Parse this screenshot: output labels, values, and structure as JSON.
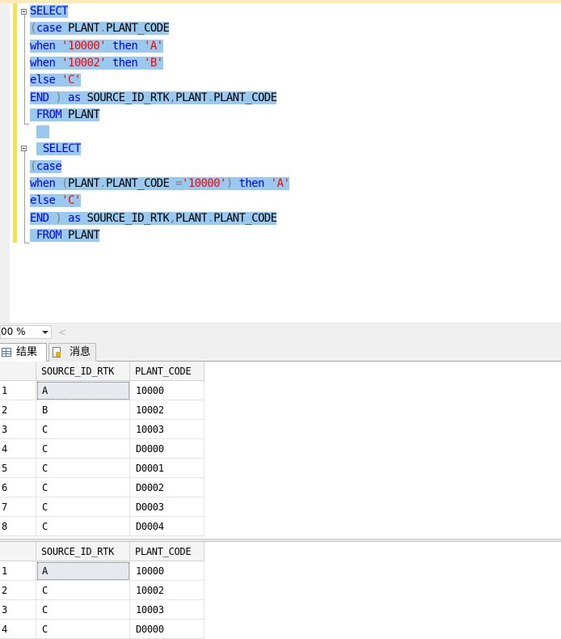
{
  "editor": {
    "lines": [
      [
        {
          "t": "SELECT",
          "c": "kw"
        }
      ],
      [
        {
          "t": "(",
          "c": "op"
        },
        {
          "t": "case",
          "c": "kw"
        },
        {
          "t": " PLANT",
          "c": "id"
        },
        {
          "t": ".",
          "c": "op"
        },
        {
          "t": "PLANT_CODE",
          "c": "id"
        }
      ],
      [
        {
          "t": "when",
          "c": "kw"
        },
        {
          "t": " ",
          "c": "id"
        },
        {
          "t": "'10000'",
          "c": "str"
        },
        {
          "t": " ",
          "c": "id"
        },
        {
          "t": "then",
          "c": "kw"
        },
        {
          "t": " ",
          "c": "id"
        },
        {
          "t": "'A'",
          "c": "str"
        }
      ],
      [
        {
          "t": "when",
          "c": "kw"
        },
        {
          "t": " ",
          "c": "id"
        },
        {
          "t": "'10002'",
          "c": "str"
        },
        {
          "t": " ",
          "c": "id"
        },
        {
          "t": "then",
          "c": "kw"
        },
        {
          "t": " ",
          "c": "id"
        },
        {
          "t": "'B'",
          "c": "str"
        }
      ],
      [
        {
          "t": "else",
          "c": "kw"
        },
        {
          "t": " ",
          "c": "id"
        },
        {
          "t": "'C'",
          "c": "str"
        }
      ],
      [
        {
          "t": "END",
          "c": "kw"
        },
        {
          "t": " ",
          "c": "id"
        },
        {
          "t": ")",
          "c": "op"
        },
        {
          "t": " ",
          "c": "id"
        },
        {
          "t": "as",
          "c": "kw"
        },
        {
          "t": " SOURCE_ID_RTK",
          "c": "id"
        },
        {
          "t": ",",
          "c": "op"
        },
        {
          "t": "PLANT",
          "c": "id"
        },
        {
          "t": ".",
          "c": "op"
        },
        {
          "t": "PLANT_CODE",
          "c": "id"
        }
      ],
      [
        {
          "t": " ",
          "c": "id"
        },
        {
          "t": "FROM",
          "c": "kw"
        },
        {
          "t": " PLANT",
          "c": "id"
        }
      ],
      [
        {
          "t": "  ",
          "c": "id"
        }
      ],
      [
        {
          "t": " ",
          "c": "id"
        },
        {
          "t": "SELECT",
          "c": "kw"
        }
      ],
      [
        {
          "t": "(",
          "c": "op"
        },
        {
          "t": "case",
          "c": "kw"
        }
      ],
      [
        {
          "t": "when",
          "c": "kw"
        },
        {
          "t": " ",
          "c": "id"
        },
        {
          "t": "(",
          "c": "op"
        },
        {
          "t": "PLANT",
          "c": "id"
        },
        {
          "t": ".",
          "c": "op"
        },
        {
          "t": "PLANT_CODE ",
          "c": "id"
        },
        {
          "t": "=",
          "c": "op"
        },
        {
          "t": "'10000'",
          "c": "str"
        },
        {
          "t": ")",
          "c": "op"
        },
        {
          "t": " ",
          "c": "id"
        },
        {
          "t": "then",
          "c": "kw"
        },
        {
          "t": " ",
          "c": "id"
        },
        {
          "t": "'A'",
          "c": "str"
        }
      ],
      [
        {
          "t": "else",
          "c": "kw"
        },
        {
          "t": " ",
          "c": "id"
        },
        {
          "t": "'C'",
          "c": "str"
        }
      ],
      [
        {
          "t": "END",
          "c": "kw"
        },
        {
          "t": " ",
          "c": "id"
        },
        {
          "t": ")",
          "c": "op"
        },
        {
          "t": " ",
          "c": "id"
        },
        {
          "t": "as",
          "c": "kw"
        },
        {
          "t": " SOURCE_ID_RTK",
          "c": "id"
        },
        {
          "t": ",",
          "c": "op"
        },
        {
          "t": "PLANT",
          "c": "id"
        },
        {
          "t": ".",
          "c": "op"
        },
        {
          "t": "PLANT_CODE",
          "c": "id"
        }
      ],
      [
        {
          "t": " ",
          "c": "id"
        },
        {
          "t": "FROM",
          "c": "kw"
        },
        {
          "t": " PLANT",
          "c": "id"
        }
      ]
    ]
  },
  "status": {
    "zoom": "00 %",
    "scroll_left": "<"
  },
  "tabs": {
    "results": "结果",
    "messages": "消息"
  },
  "grid1": {
    "columns": [
      "SOURCE_ID_RTK",
      "PLANT_CODE"
    ],
    "rows": [
      [
        "1",
        "A",
        "10000"
      ],
      [
        "2",
        "B",
        "10002"
      ],
      [
        "3",
        "C",
        "10003"
      ],
      [
        "4",
        "C",
        "D0000"
      ],
      [
        "5",
        "C",
        "D0001"
      ],
      [
        "6",
        "C",
        "D0002"
      ],
      [
        "7",
        "C",
        "D0003"
      ],
      [
        "8",
        "C",
        "D0004"
      ]
    ]
  },
  "grid2": {
    "columns": [
      "SOURCE_ID_RTK",
      "PLANT_CODE"
    ],
    "rows": [
      [
        "1",
        "A",
        "10000"
      ],
      [
        "2",
        "C",
        "10002"
      ],
      [
        "3",
        "C",
        "10003"
      ],
      [
        "4",
        "C",
        "D0000"
      ]
    ]
  }
}
